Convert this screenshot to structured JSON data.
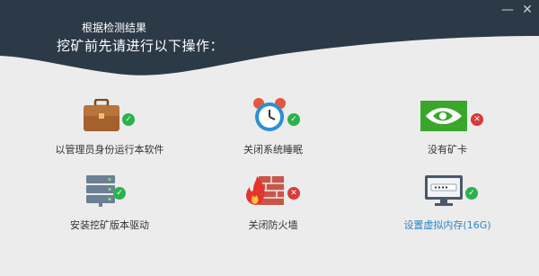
{
  "header": {
    "subtitle": "根据检测结果",
    "title": "挖矿前先请进行以下操作：",
    "min_label": "—",
    "close_label": "✕"
  },
  "items": [
    {
      "label": "以管理员身份运行本软件",
      "status": "ok",
      "icon": "briefcase-icon"
    },
    {
      "label": "关闭系统睡眠",
      "status": "ok",
      "icon": "alarm-clock-icon"
    },
    {
      "label": "没有矿卡",
      "status": "fail",
      "icon": "nvidia-icon"
    },
    {
      "label": "安装挖矿版本驱动",
      "status": "ok",
      "icon": "server-icon"
    },
    {
      "label": "关闭防火墙",
      "status": "fail",
      "icon": "firewall-icon"
    },
    {
      "label": "设置虚拟内存(16G)",
      "status": "ok",
      "icon": "monitor-password-icon"
    }
  ],
  "status_glyphs": {
    "ok": "✓",
    "fail": "✕"
  },
  "colors": {
    "header": "#2c3a47",
    "ok": "#2bb24c",
    "fail": "#d83b3b",
    "link": "#2a86c8"
  }
}
